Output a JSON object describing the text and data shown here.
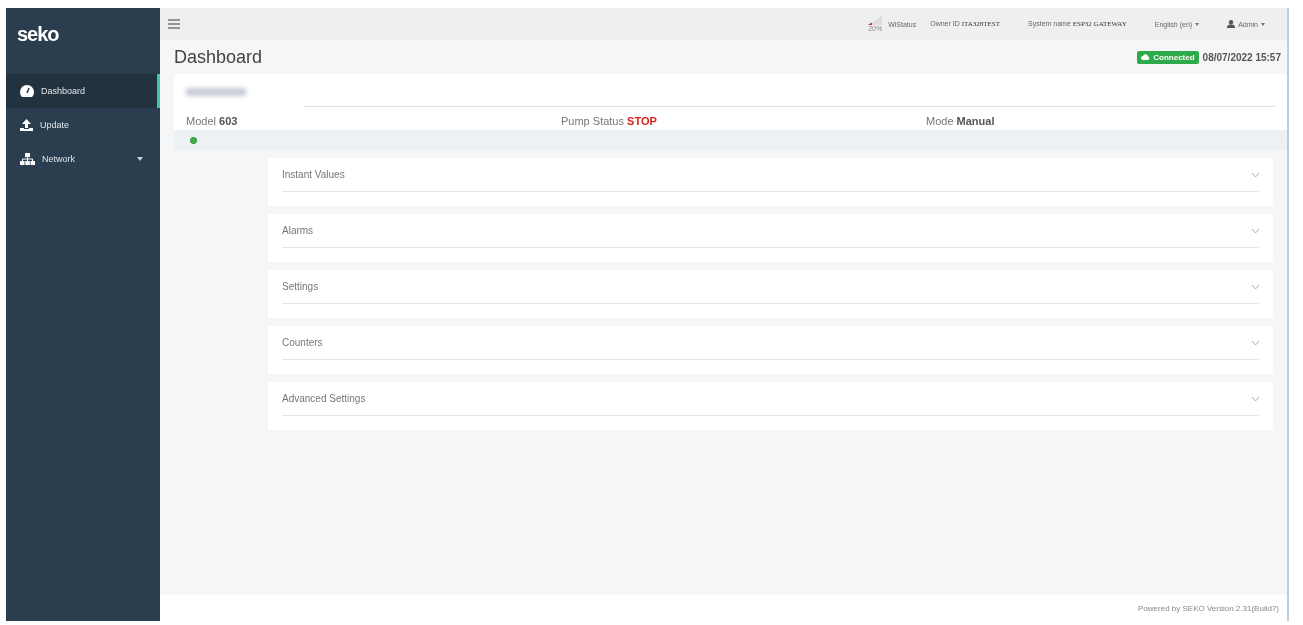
{
  "sidebar": {
    "logo": "seko",
    "items": [
      {
        "label": "Dashboard",
        "selected": true,
        "has_submenu": false
      },
      {
        "label": "Update",
        "selected": false,
        "has_submenu": false
      },
      {
        "label": "Network",
        "selected": false,
        "has_submenu": true
      }
    ]
  },
  "topbar": {
    "signal": {
      "reading": "20%"
    },
    "wifi_status": "WiStatus",
    "owner": {
      "label": "Owner ID",
      "value": "ITA328TEST"
    },
    "system": {
      "label": "System name",
      "value": "ESP32 GATEWAY"
    },
    "language": "English (en)",
    "user": "Admin"
  },
  "page": {
    "title": "Dashboard",
    "connection": {
      "label": "Connected",
      "connected": true
    },
    "datetime": "08/07/2022 15:57"
  },
  "device": {
    "fields": [
      {
        "label": "Model",
        "value": "603",
        "kind": "plain"
      },
      {
        "label": "Pump Status",
        "value": "STOP",
        "kind": "alert"
      },
      {
        "label": "Mode",
        "value": "Manual",
        "kind": "plain"
      }
    ],
    "online": true
  },
  "sections": [
    {
      "title": "Instant Values",
      "expanded": false
    },
    {
      "title": "Alarms",
      "expanded": false
    },
    {
      "title": "Settings",
      "expanded": false
    },
    {
      "title": "Counters",
      "expanded": false
    },
    {
      "title": "Advanced Settings",
      "expanded": false
    }
  ],
  "footer": "Powered by SEKO Version 2.31(Build7)"
}
